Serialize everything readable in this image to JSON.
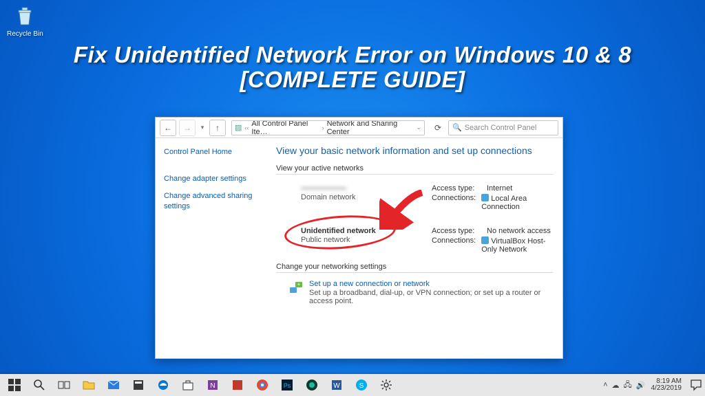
{
  "desktop": {
    "recycle_bin": "Recycle Bin"
  },
  "headline": {
    "line1": "Fix Unidentified Network Error on Windows 10 & 8",
    "line2": "[COMPLETE GUIDE]"
  },
  "window": {
    "breadcrumb": {
      "seg1": "All Control Panel Ite…",
      "seg2": "Network and Sharing Center"
    },
    "search_placeholder": "Search Control Panel",
    "sidebar": {
      "home": "Control Panel Home",
      "links": [
        "Change adapter settings",
        "Change advanced sharing settings"
      ]
    },
    "heading": "View your basic network information and set up connections",
    "section_active": "View your active networks",
    "net1": {
      "title_blurred": "——————",
      "sub": "Domain network",
      "access_k": "Access type:",
      "access_v": "Internet",
      "conn_k": "Connections:",
      "conn_v_blurred": "Local Area Connection"
    },
    "net2": {
      "title": "Unidentified network",
      "sub": "Public network",
      "access_k": "Access type:",
      "access_v": "No network access",
      "conn_k": "Connections:",
      "conn_v_blurred": "VirtualBox Host-Only Network"
    },
    "section_change": "Change your networking settings",
    "change": {
      "t1": "Set up a new connection or network",
      "t2": "Set up a broadband, dial-up, or VPN connection; or set up a router or access point."
    }
  },
  "taskbar": {
    "time": "8:19 AM",
    "date": "4/23/2019"
  }
}
